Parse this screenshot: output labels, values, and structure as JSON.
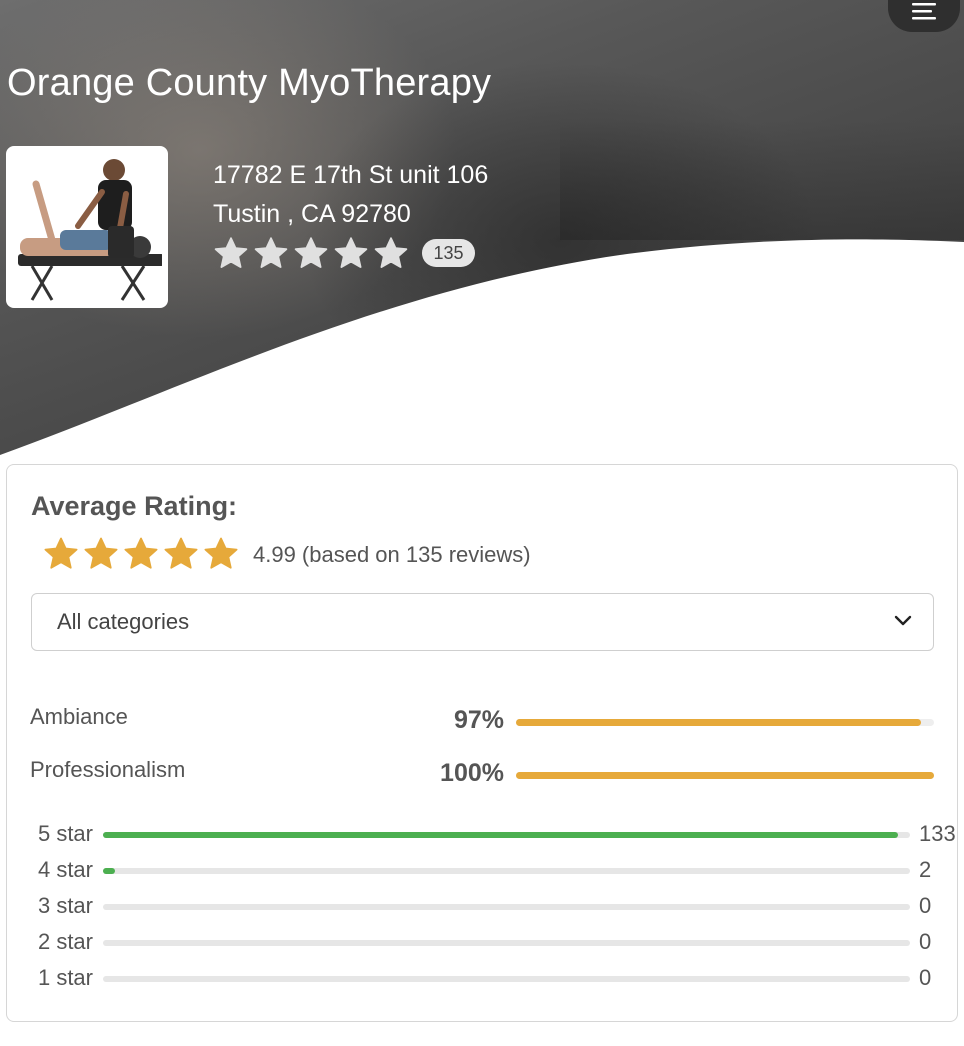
{
  "header": {
    "business_name": "Orange County MyoTherapy",
    "address_line1": "17782 E 17th St unit 106",
    "address_line2": "Tustin , CA 92780",
    "review_count": "135",
    "menu_icon": "hamburger-menu-icon",
    "thumbnail_icon": "massage-therapist-photo"
  },
  "rating": {
    "heading": "Average Rating:",
    "stars_filled": 5,
    "summary": "4.99 (based on 135 reviews)",
    "star_color": "#e6a93a"
  },
  "category_select": {
    "selected": "All categories",
    "icon": "chevron-down-icon"
  },
  "categories": [
    {
      "label": "Ambiance",
      "percent_text": "97%",
      "value": 97
    },
    {
      "label": "Professionalism",
      "percent_text": "100%",
      "value": 100
    }
  ],
  "star_breakdown": [
    {
      "label": "5 star",
      "count": "133",
      "value": 133
    },
    {
      "label": "4 star",
      "count": "2",
      "value": 2
    },
    {
      "label": "3 star",
      "count": "0",
      "value": 0
    },
    {
      "label": "2 star",
      "count": "0",
      "value": 0
    },
    {
      "label": "1 star",
      "count": "0",
      "value": 0
    }
  ],
  "colors": {
    "category_bar": "#e6a93a",
    "star_bar": "#4caf50",
    "hero_star_empty": "#e0e0e0"
  }
}
